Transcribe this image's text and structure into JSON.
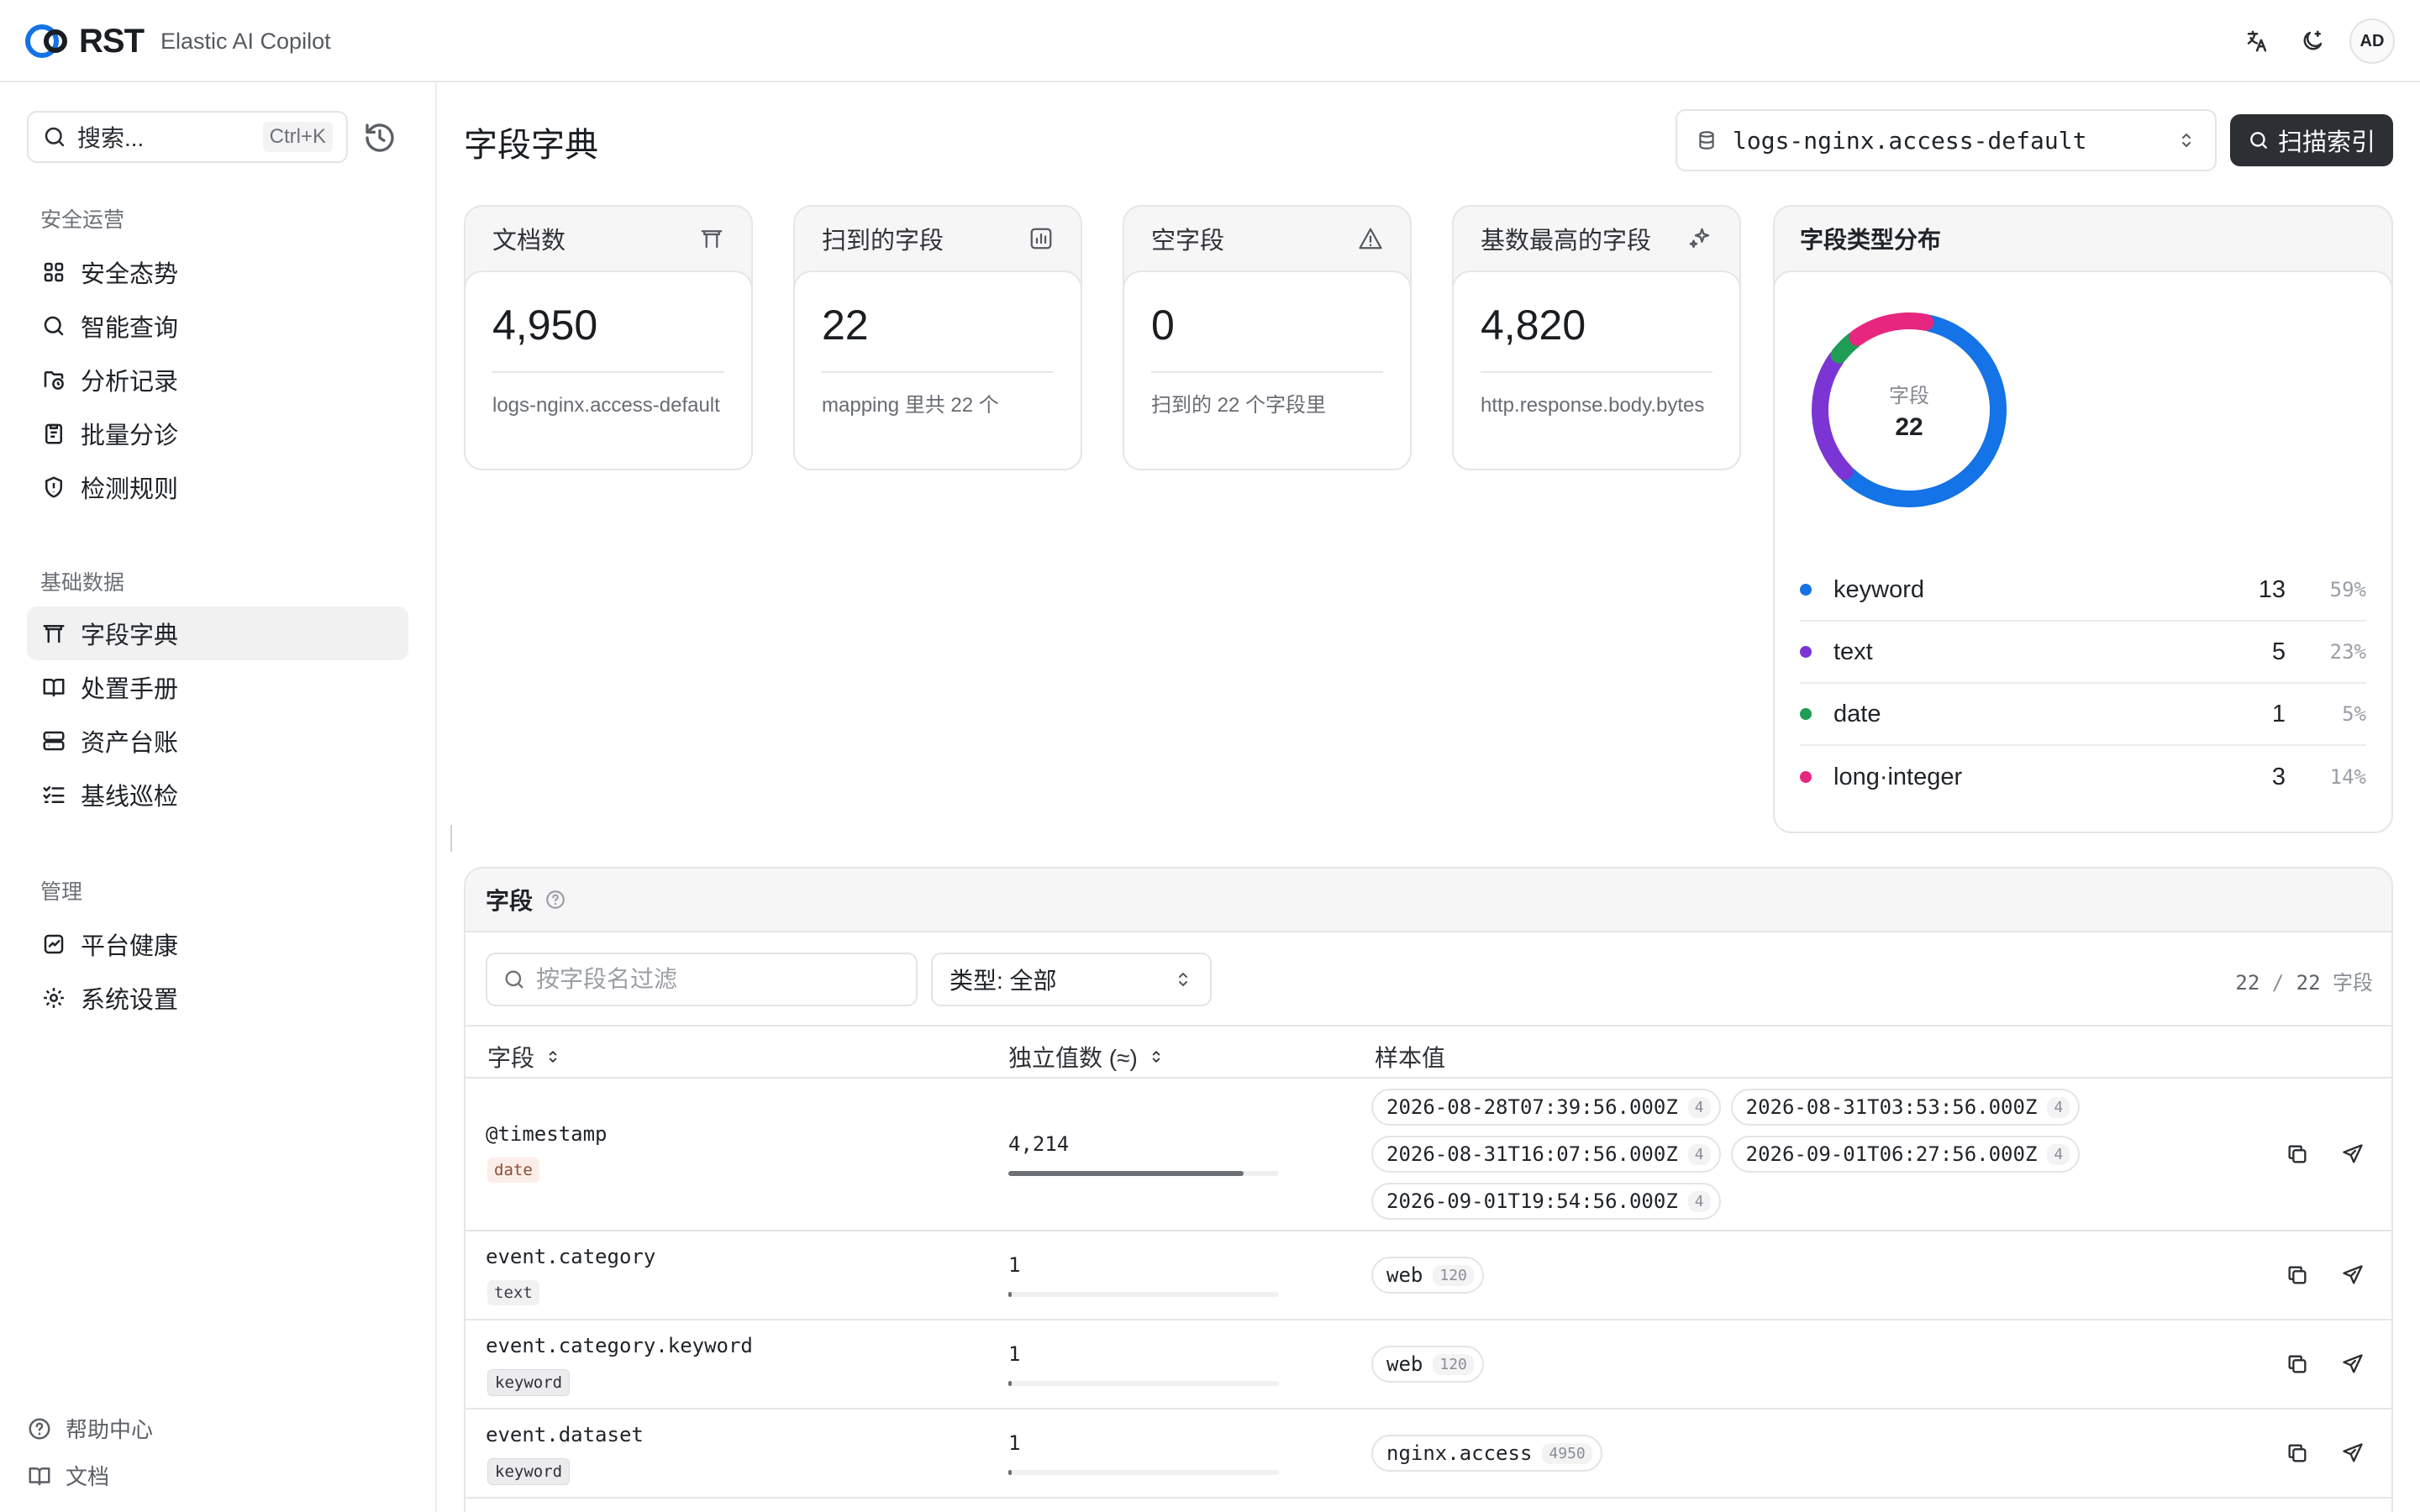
{
  "app": {
    "logo_text": "RST",
    "title": "Elastic AI Copilot"
  },
  "topbar": {
    "translate_icon": "translate-icon",
    "theme_icon": "moon-icon",
    "avatar": "AD"
  },
  "sidebar": {
    "search_placeholder": "搜索...",
    "search_shortcut": "Ctrl+K",
    "sections": [
      {
        "label": "安全运营",
        "items": [
          {
            "label": "安全态势",
            "icon": "grid-icon"
          },
          {
            "label": "智能查询",
            "icon": "search-icon"
          },
          {
            "label": "分析记录",
            "icon": "history-folder-icon"
          },
          {
            "label": "批量分诊",
            "icon": "clipboard-icon"
          },
          {
            "label": "检测规则",
            "icon": "shield-icon"
          }
        ]
      },
      {
        "label": "基础数据",
        "items": [
          {
            "label": "字段字典",
            "icon": "table-icon",
            "active": true
          },
          {
            "label": "处置手册",
            "icon": "book-icon"
          },
          {
            "label": "资产台账",
            "icon": "server-icon"
          },
          {
            "label": "基线巡检",
            "icon": "checklist-icon"
          }
        ]
      },
      {
        "label": "管理",
        "items": [
          {
            "label": "平台健康",
            "icon": "activity-icon"
          },
          {
            "label": "系统设置",
            "icon": "gear-icon"
          }
        ]
      }
    ],
    "footer": [
      {
        "label": "帮助中心",
        "icon": "help-icon"
      },
      {
        "label": "文档",
        "icon": "book-icon"
      }
    ]
  },
  "page": {
    "title": "字段字典",
    "index_select": "logs-nginx.access-default",
    "scan_button": "扫描索引"
  },
  "stats": [
    {
      "label": "文档数",
      "value": "4,950",
      "sub": "logs-nginx.access-default",
      "icon": "table-icon"
    },
    {
      "label": "扫到的字段",
      "value": "22",
      "sub": "mapping 里共 22 个",
      "icon": "chart-icon"
    },
    {
      "label": "空字段",
      "value": "0",
      "sub": "扫到的 22 个字段里",
      "icon": "warning-icon"
    },
    {
      "label": "基数最高的字段",
      "value": "4,820",
      "sub": "http.response.body.bytes",
      "icon": "sparkle-icon"
    }
  ],
  "distribution": {
    "title": "字段类型分布",
    "center_label": "字段",
    "center_value": "22",
    "items": [
      {
        "name": "keyword",
        "count": "13",
        "pct": "59%",
        "color": "#1473e6",
        "value": 13
      },
      {
        "name": "text",
        "count": "5",
        "pct": "23%",
        "color": "#7b35d4",
        "value": 5
      },
      {
        "name": "date",
        "count": "1",
        "pct": "5%",
        "color": "#1f9d55",
        "value": 1
      },
      {
        "name": "long·integer",
        "count": "3",
        "pct": "14%",
        "color": "#e6267f",
        "value": 3
      }
    ]
  },
  "fields": {
    "title": "字段",
    "filter_placeholder": "按字段名过滤",
    "type_filter": "类型: 全部",
    "count_shown": "22",
    "count_sep": " / ",
    "count_total": "22",
    "count_unit": " 字段",
    "columns": {
      "field": "字段",
      "cardinality": "独立值数 (≈)",
      "samples": "样本值"
    },
    "rows": [
      {
        "name": "@timestamp",
        "type": "date",
        "cardinality": "4,214",
        "fill": 0.87,
        "samples": [
          {
            "v": "2026-08-28T07:39:56.000Z",
            "c": "4"
          },
          {
            "v": "2026-08-31T03:53:56.000Z",
            "c": "4"
          },
          {
            "v": "2026-08-31T16:07:56.000Z",
            "c": "4"
          },
          {
            "v": "2026-09-01T06:27:56.000Z",
            "c": "4"
          },
          {
            "v": "2026-09-01T19:54:56.000Z",
            "c": "4"
          }
        ]
      },
      {
        "name": "event.category",
        "type": "text",
        "cardinality": "1",
        "fill": 0.0002,
        "samples": [
          {
            "v": "web",
            "c": "120"
          }
        ]
      },
      {
        "name": "event.category.keyword",
        "type": "keyword",
        "cardinality": "1",
        "fill": 0.0002,
        "samples": [
          {
            "v": "web",
            "c": "120"
          }
        ]
      },
      {
        "name": "event.dataset",
        "type": "keyword",
        "cardinality": "1",
        "fill": 0.0002,
        "samples": [
          {
            "v": "nginx.access",
            "c": "4950"
          }
        ]
      }
    ]
  }
}
